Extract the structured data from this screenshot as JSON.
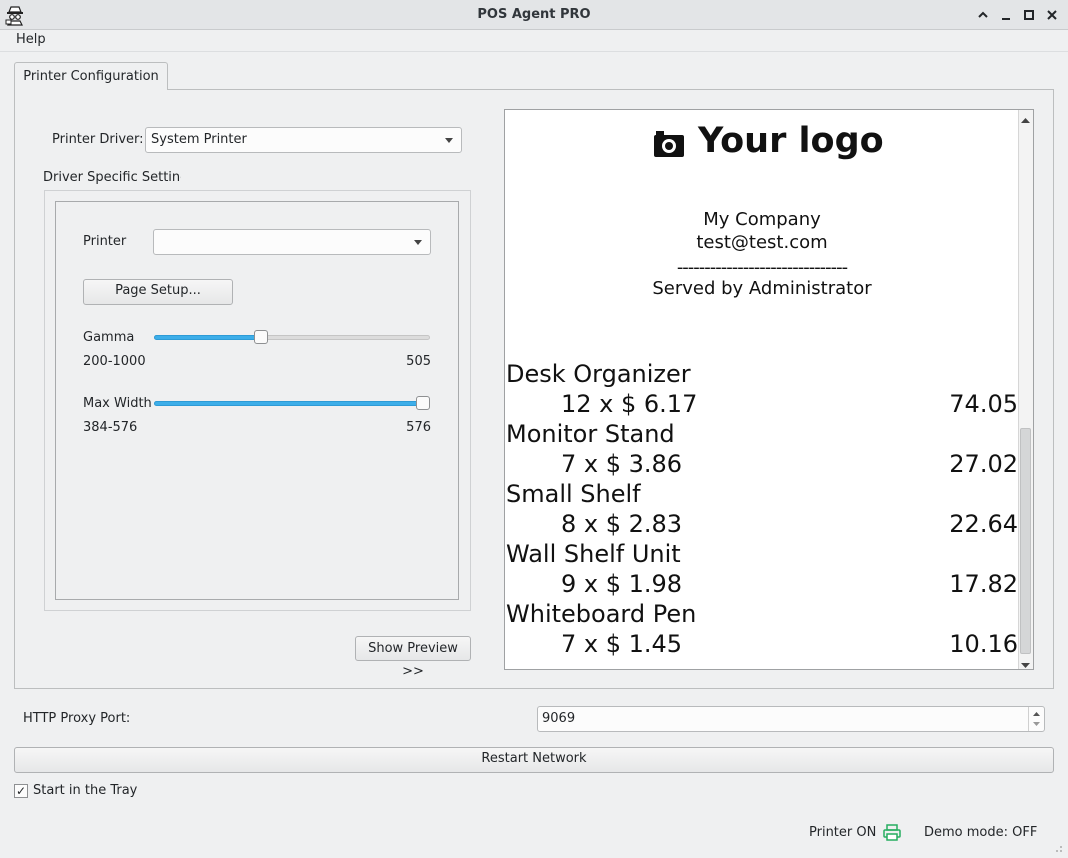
{
  "window": {
    "title": "POS Agent PRO",
    "controls": [
      "chevron-up",
      "minimize",
      "maximize",
      "close"
    ]
  },
  "menu": {
    "help": "Help"
  },
  "tabs": [
    {
      "label": "Printer Configuration",
      "active": true
    }
  ],
  "printer_config": {
    "driver_label": "Printer Driver:",
    "driver_value": "System Printer",
    "driver_settings_title": "Driver Specific Settings",
    "printer_label": "Printer",
    "printer_value": "",
    "page_setup_label": "Page Setup...",
    "gamma": {
      "label": "Gamma",
      "range_text": "200-1000",
      "value": "505",
      "min": 200,
      "max": 1000
    },
    "max_width": {
      "label": "Max Width",
      "range_text": "384-576",
      "value": "576",
      "min": 384,
      "max": 576
    },
    "show_preview_label": "Show Preview >>"
  },
  "receipt": {
    "logo_text": "Your logo",
    "company": "My Company",
    "email": "test@test.com",
    "separator": "-------------------------------",
    "served_by": "Served by Administrator",
    "items": [
      {
        "name": "Desk Organizer",
        "qty_price": "12 x $ 6.17",
        "total": "74.05"
      },
      {
        "name": "Monitor Stand",
        "qty_price": "7 x $ 3.86",
        "total": "27.02"
      },
      {
        "name": "Small Shelf",
        "qty_price": "8 x $ 2.83",
        "total": "22.64"
      },
      {
        "name": "Wall Shelf Unit",
        "qty_price": "9 x $ 1.98",
        "total": "17.82"
      },
      {
        "name": "Whiteboard Pen",
        "qty_price": "7 x $ 1.45",
        "total": "10.16"
      }
    ]
  },
  "network": {
    "proxy_label": "HTTP Proxy Port:",
    "proxy_value": "9069",
    "restart_label": "Restart Network",
    "tray_label": "Start in the Tray",
    "tray_checked": true
  },
  "status": {
    "printer": "Printer ON",
    "demo": "Demo mode: OFF",
    "printer_icon_color": "#27ae60"
  },
  "colors": {
    "accent": "#3daee9"
  }
}
